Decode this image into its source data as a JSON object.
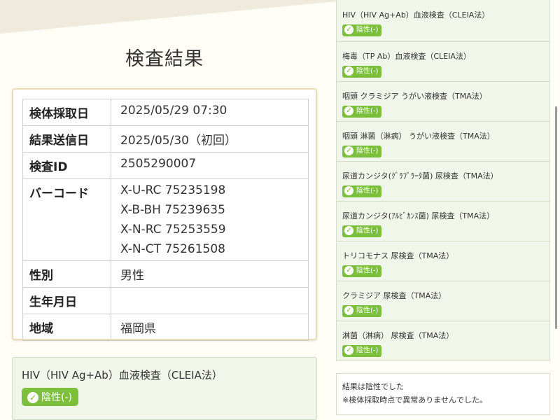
{
  "page": {
    "title": "検査結果"
  },
  "info": {
    "rows": [
      {
        "label": "検体採取日",
        "value": "2025/05/29 07:30"
      },
      {
        "label": "結果送信日",
        "value": "2025/05/30（初回）"
      },
      {
        "label": "検査ID",
        "value": "2505290007"
      },
      {
        "label": "バーコード",
        "values": [
          "X-U-RC 75235198",
          "X-B-BH 75239635",
          "X-N-RC 75253559",
          "X-N-CT 75261508"
        ]
      },
      {
        "label": "性別",
        "value": "男性"
      },
      {
        "label": "生年月日",
        "value": ""
      },
      {
        "label": "地域",
        "value": "福岡県"
      }
    ]
  },
  "left_result": {
    "name": "HIV（HIV Ag+Ab）血液検査（CLEIA法）",
    "badge": "陰性(-)"
  },
  "tests": [
    {
      "name": "HIV（HIV Ag+Ab）血液検査（CLEIA法）",
      "badge": "陰性(-)"
    },
    {
      "name": "梅毒（TP Ab）血液検査（CLEIA法）",
      "badge": "陰性(-)"
    },
    {
      "name": "咽頭 クラミジア うがい液検査（TMA法）",
      "badge": "陰性(-)"
    },
    {
      "name": "咽頭 淋菌（淋病） うがい液検査（TMA法）",
      "badge": "陰性(-)"
    },
    {
      "name": "尿道カンジタ(ｸﾞﾗﾌﾞﾗｰﾀ菌) 尿検査（TMA法）",
      "badge": "陰性(-)"
    },
    {
      "name": "尿道カンジタ(ｱﾙﾋﾞｶﾝｽ菌) 尿検査（TMA法）",
      "badge": "陰性(-)"
    },
    {
      "name": "トリコモナス 尿検査（TMA法）",
      "badge": "陰性(-)"
    },
    {
      "name": "クラミジア 尿検査（TMA法）",
      "badge": "陰性(-)"
    },
    {
      "name": "淋菌（淋病） 尿検査（TMA法）",
      "badge": "陰性(-)"
    }
  ],
  "summary": {
    "line1": "結果は陰性でした",
    "line2": "※検体採取時点で異常ありませんでした。"
  },
  "colors": {
    "badge_green": "#7cbf3c",
    "panel_bg": "#f1f6ea",
    "card_border": "#ecdcb6"
  }
}
